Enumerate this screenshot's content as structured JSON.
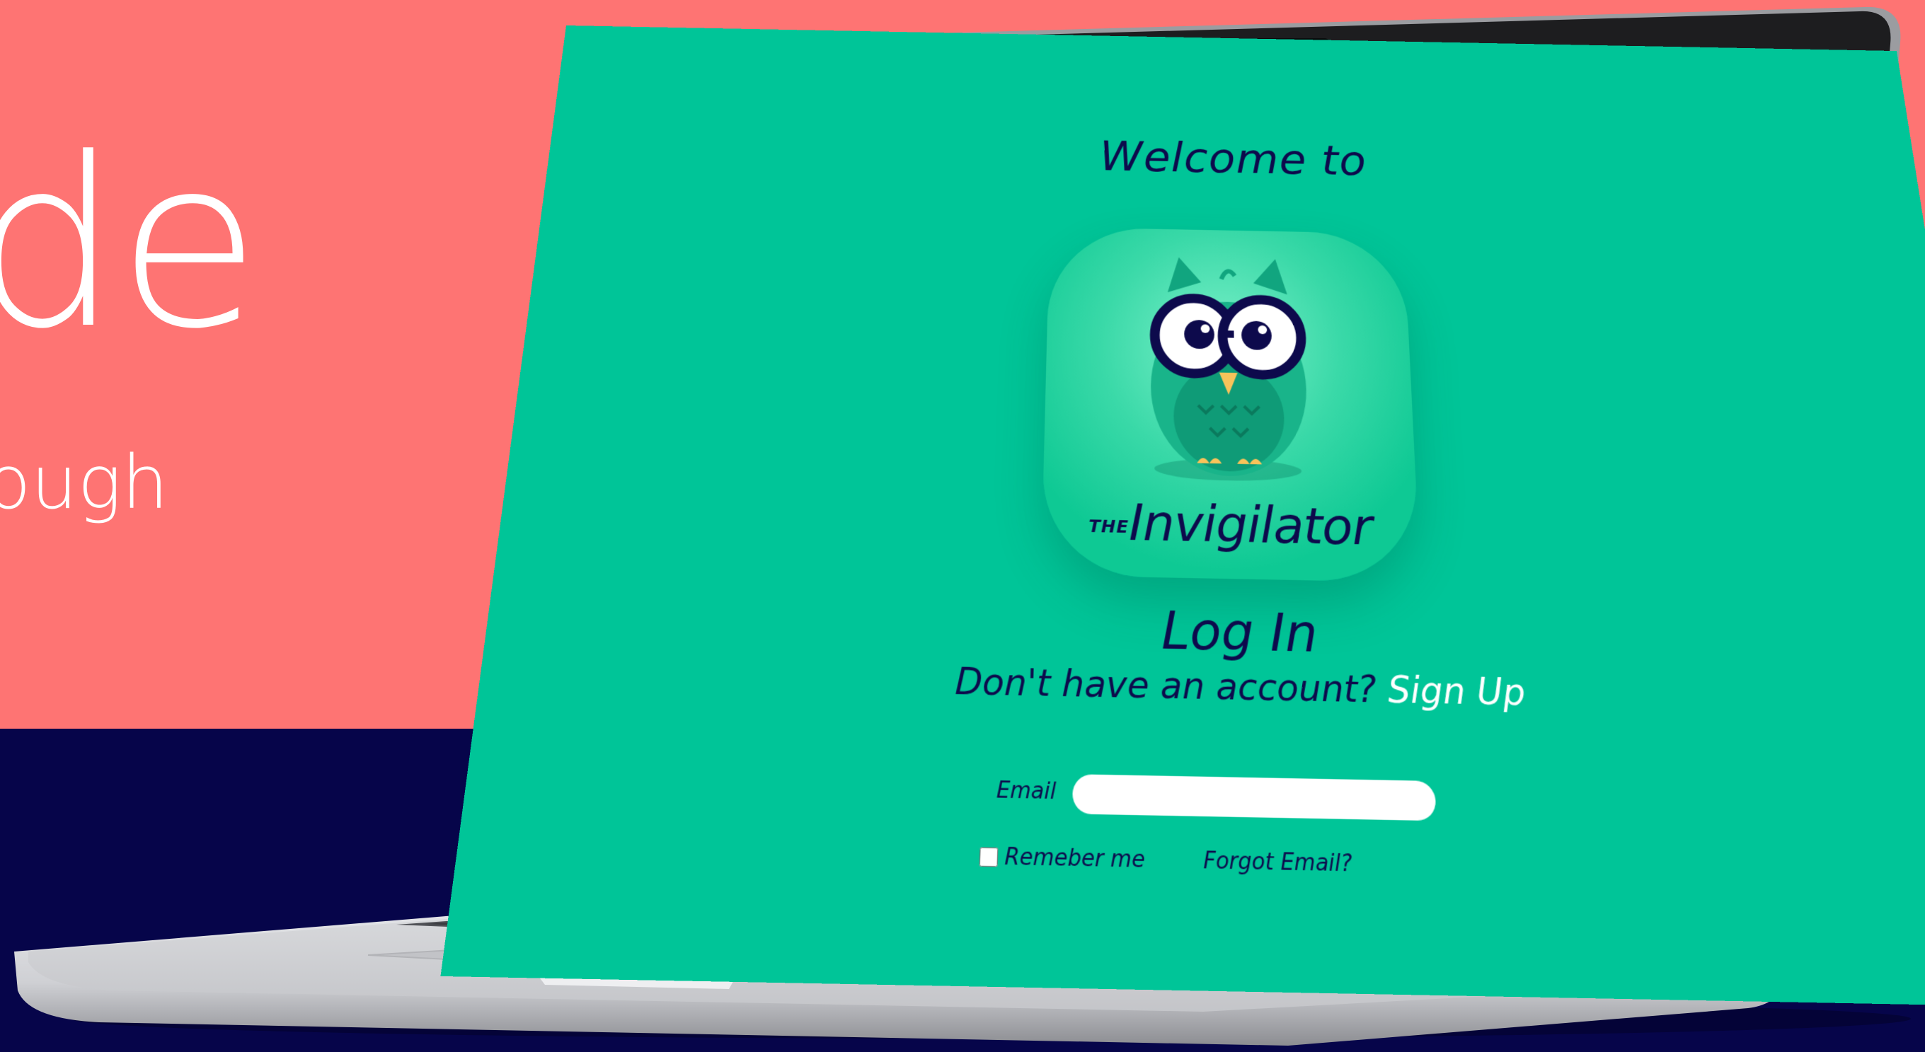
{
  "background": {
    "top_color": "#fe7473",
    "bottom_color": "#06054a",
    "hero_word": "de",
    "hero_subword": "ough"
  },
  "laptop": {
    "webcam": "webcam-icon",
    "ports": [
      "sd-card-slot",
      "usb-c-port",
      "hdmi-port"
    ]
  },
  "screen": {
    "background_color": "#00c598",
    "welcome_text": "Welcome to",
    "logo": {
      "icon": "owl-mascot-icon",
      "prefix": "THE",
      "name": "Invigilator"
    },
    "login_title": "Log In",
    "signup_prompt": "Don't have an account?",
    "signup_link": "Sign Up",
    "email_label": "Email",
    "email_value": "",
    "remember_label": "Remeber me",
    "forgot_link": "Forgot Email?"
  }
}
